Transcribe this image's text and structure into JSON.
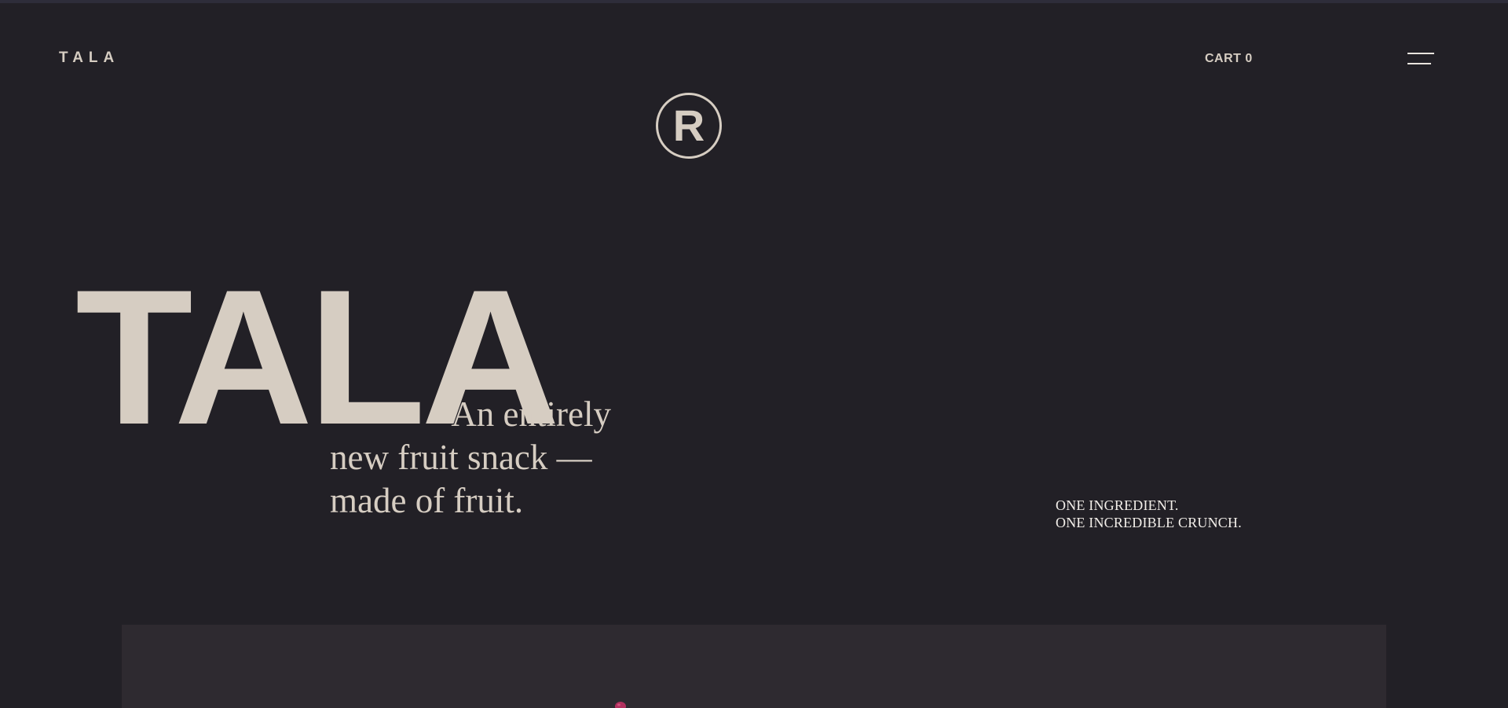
{
  "header": {
    "logo": "TALA",
    "cart_label": "CART 0",
    "menu_icon": "hamburger-menu-icon"
  },
  "hero": {
    "wordmark": "TALA",
    "registered_symbol": "R",
    "tagline_lines": [
      "An entirely",
      "new fruit snack —",
      "made of fruit."
    ],
    "side_copy_lines": [
      "ONE INGREDIENT.",
      "ONE INCREDIBLE CRUNCH."
    ]
  },
  "colors": {
    "background": "#222026",
    "text": "#d6cdc2",
    "panel": "#2e2a30",
    "accent_fruit": "#b0305e"
  }
}
